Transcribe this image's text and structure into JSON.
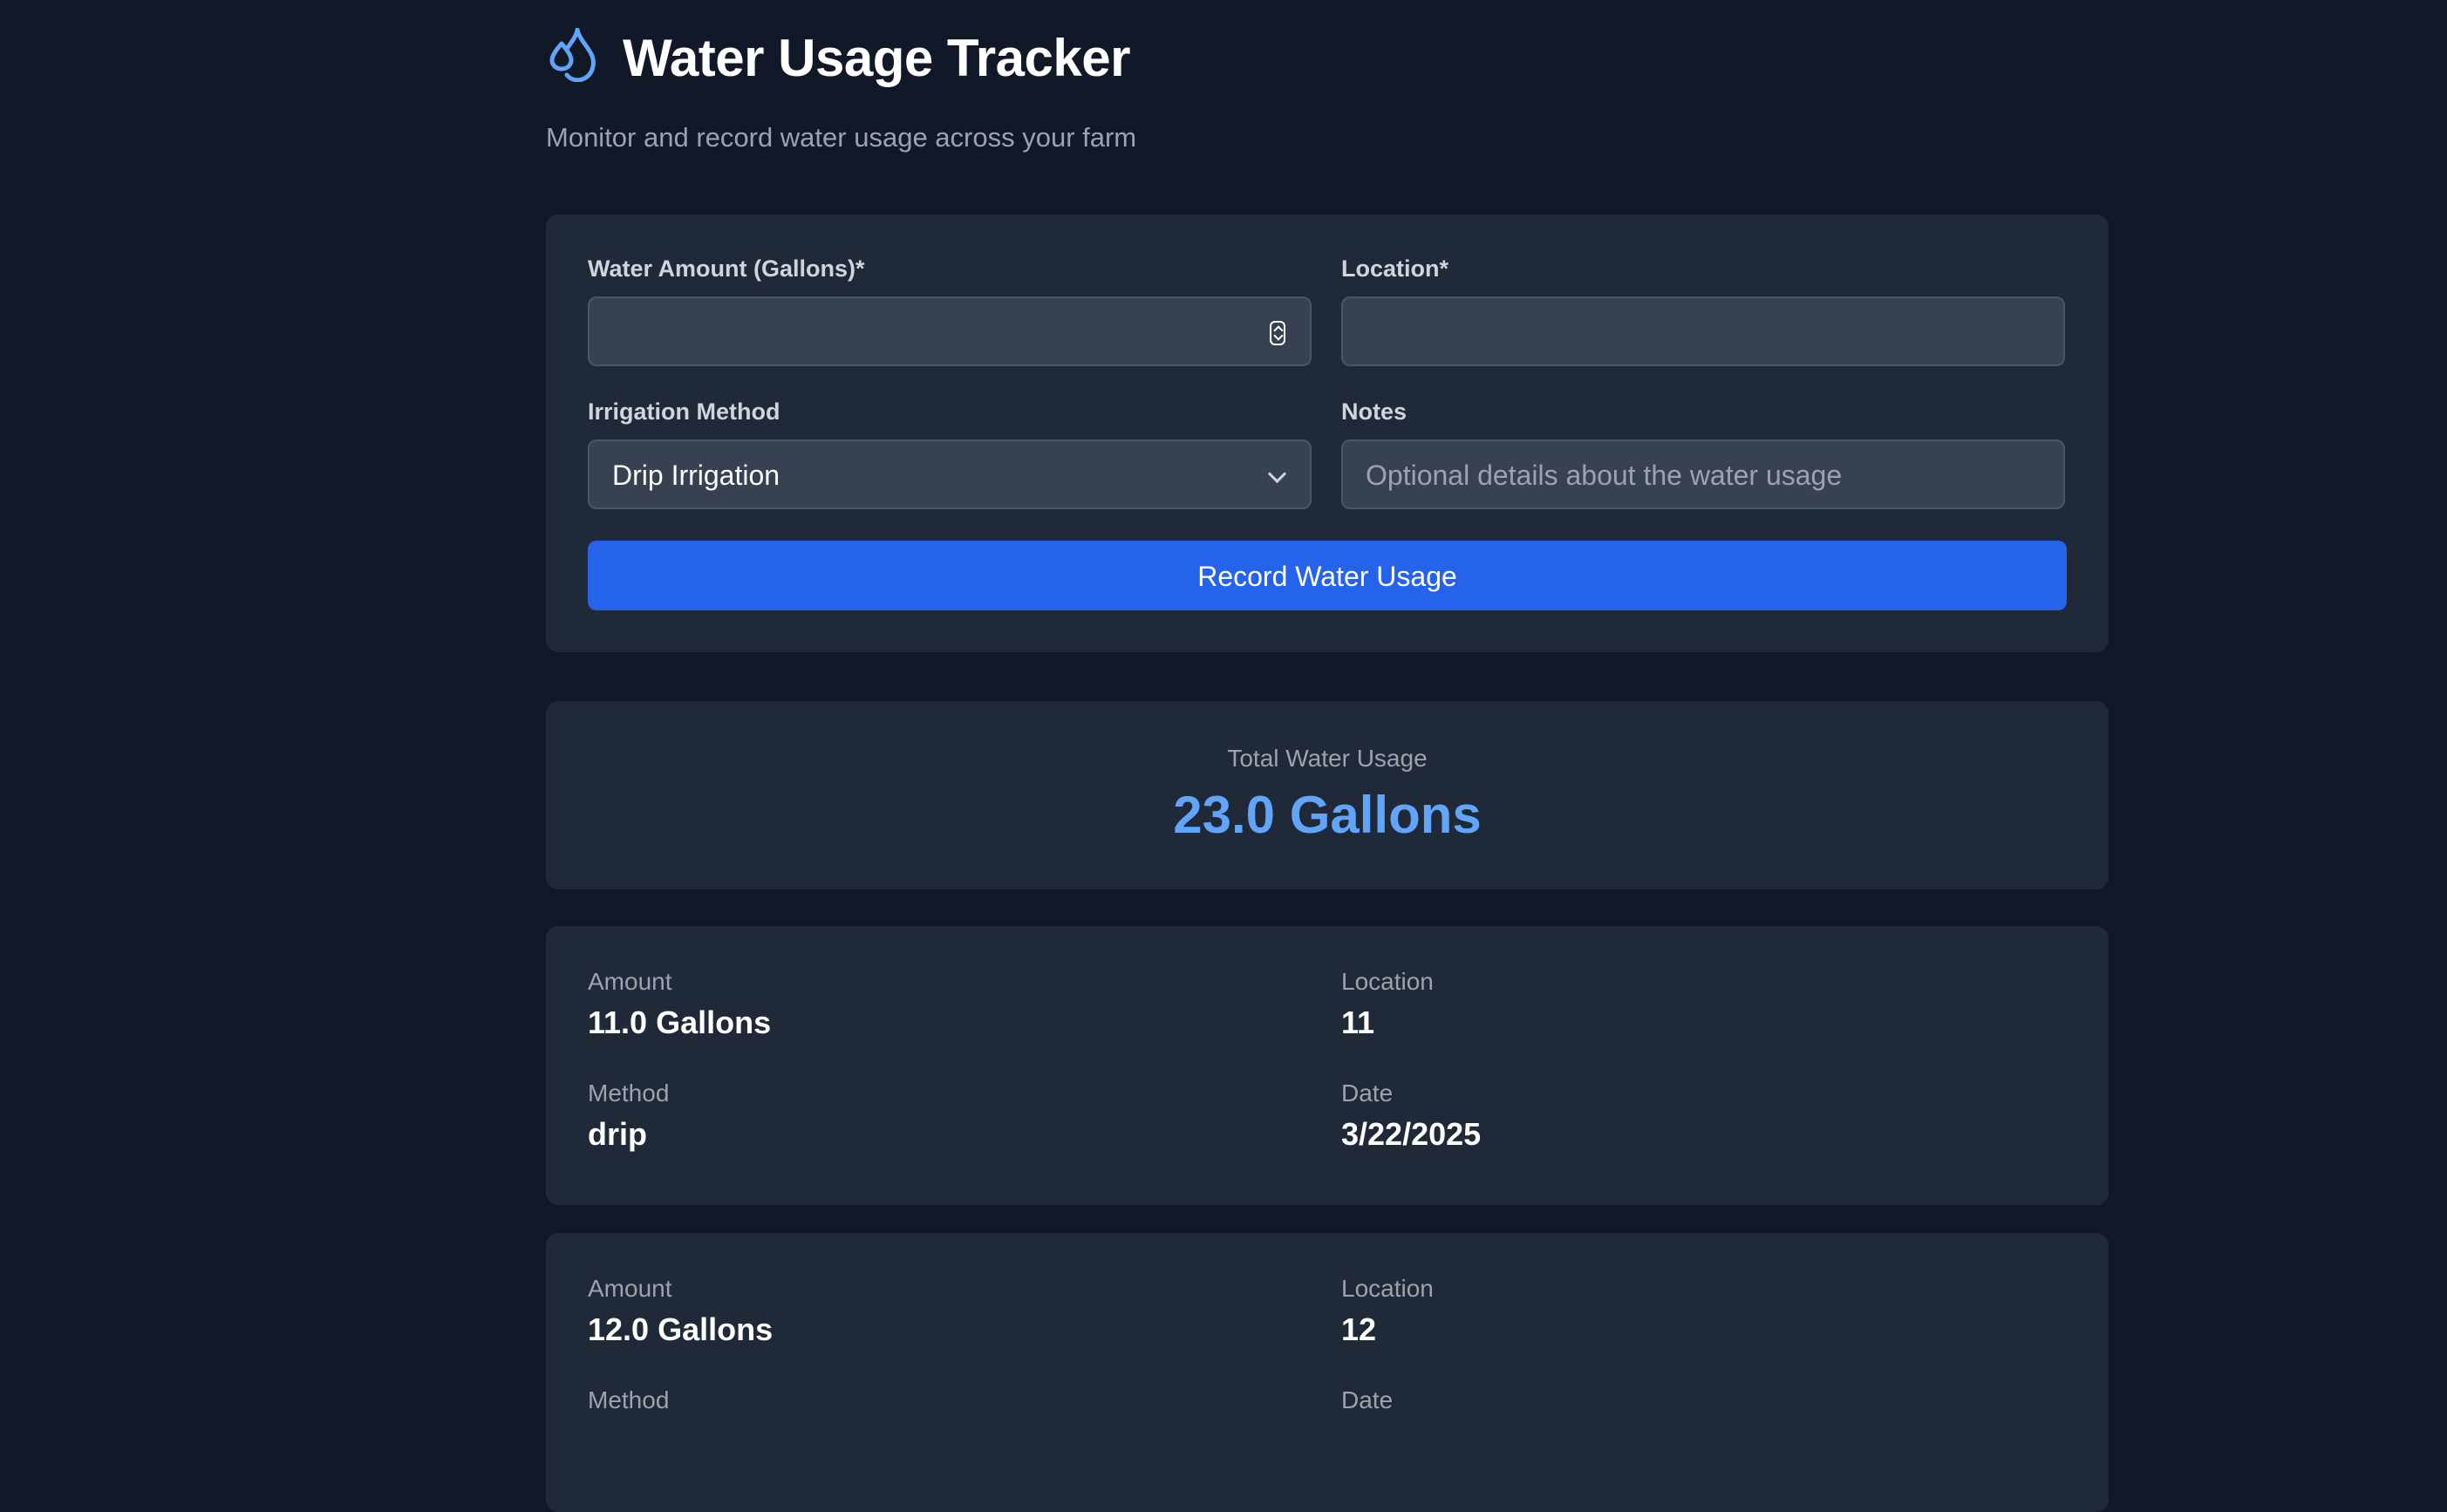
{
  "header": {
    "title": "Water Usage Tracker",
    "subtitle": "Monitor and record water usage across your farm",
    "icon": "droplets-icon",
    "accent_color": "#60a5fa"
  },
  "form": {
    "amount_label": "Water Amount (Gallons)*",
    "amount_value": "",
    "location_label": "Location*",
    "location_value": "",
    "method_label": "Irrigation Method",
    "method_selected": "Drip Irrigation",
    "notes_label": "Notes",
    "notes_placeholder": "Optional details about the water usage",
    "submit_label": "Record Water Usage",
    "submit_color": "#2563eb"
  },
  "summary": {
    "label": "Total Water Usage",
    "value": "23.0 Gallons"
  },
  "entries": [
    {
      "amount_label": "Amount",
      "amount": "11.0 Gallons",
      "location_label": "Location",
      "location": "11",
      "method_label": "Method",
      "method": "drip",
      "date_label": "Date",
      "date": "3/22/2025"
    },
    {
      "amount_label": "Amount",
      "amount": "12.0 Gallons",
      "location_label": "Location",
      "location": "12",
      "method_label": "Method",
      "method": "",
      "date_label": "Date",
      "date": ""
    }
  ]
}
